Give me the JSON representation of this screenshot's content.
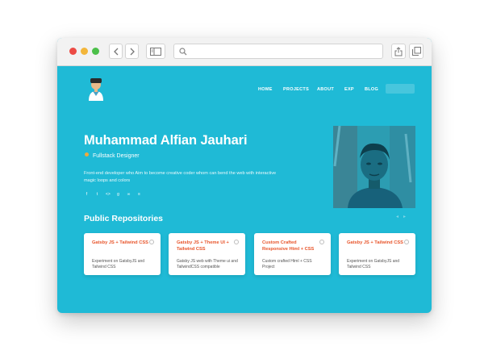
{
  "nav": {
    "items": [
      {
        "label": "HOME"
      },
      {
        "label": "PROJECTS"
      },
      {
        "label": "ABOUT"
      },
      {
        "label": "EXP"
      },
      {
        "label": "BLOG"
      }
    ]
  },
  "hero": {
    "name": "Muhammad Alfian Jauhari",
    "role": "Fullstack Designer",
    "description": "Front-end developer who Aim to become creative coder whom can bend the web with interactive magic loops and colors",
    "socials": [
      {
        "icon": "facebook-icon",
        "glyph": "f"
      },
      {
        "icon": "twitter-icon",
        "glyph": "t"
      },
      {
        "icon": "code-icon",
        "glyph": "<>"
      },
      {
        "icon": "github-icon",
        "glyph": "g"
      },
      {
        "icon": "link-icon",
        "glyph": "∞"
      },
      {
        "icon": "document-icon",
        "glyph": "≡"
      }
    ]
  },
  "repositories": {
    "title": "Public Repositories",
    "cards": [
      {
        "title": "Gatsby JS + Tailwind CSS",
        "description": "Experiment on GatsbyJS and Tailwind CSS"
      },
      {
        "title": "Gatsby JS + Theme UI + Tailwind CSS",
        "description": "Gatsby JS web with Theme ui and TailwindCSS compatible"
      },
      {
        "title": "Custom Crafted Responsive Html + CSS",
        "description": "Custom crafted Html + CSS Project"
      },
      {
        "title": "Gatsby JS + Tailwind CSS",
        "description": "Experiment on GatsbyJS and Tailwind CSS"
      }
    ]
  },
  "colors": {
    "background": "#1fbad6",
    "card_title": "#e8552b",
    "role_dot": "#f0a93c"
  }
}
